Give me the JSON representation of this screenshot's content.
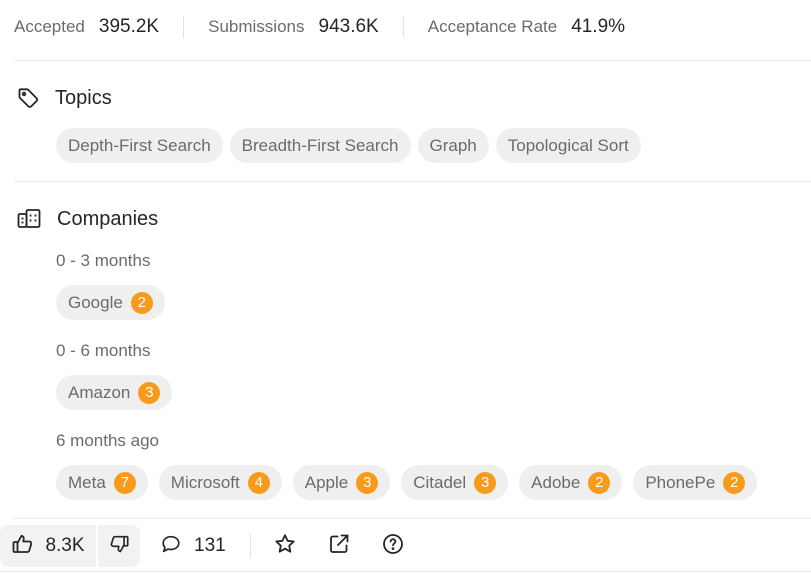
{
  "stats": {
    "accepted_label": "Accepted",
    "accepted_value": "395.2K",
    "submissions_label": "Submissions",
    "submissions_value": "943.6K",
    "acceptance_rate_label": "Acceptance Rate",
    "acceptance_rate_value": "41.9%"
  },
  "topics": {
    "title": "Topics",
    "icon": "tag-icon",
    "tags": [
      "Depth-First Search",
      "Breadth-First Search",
      "Graph",
      "Topological Sort"
    ]
  },
  "companies": {
    "title": "Companies",
    "icon": "building-icon",
    "groups": [
      {
        "period": "0 - 3 months",
        "items": [
          {
            "name": "Google",
            "count": "2"
          }
        ]
      },
      {
        "period": "0 - 6 months",
        "items": [
          {
            "name": "Amazon",
            "count": "3"
          }
        ]
      },
      {
        "period": "6 months ago",
        "items": [
          {
            "name": "Meta",
            "count": "7"
          },
          {
            "name": "Microsoft",
            "count": "4"
          },
          {
            "name": "Apple",
            "count": "3"
          },
          {
            "name": "Citadel",
            "count": "3"
          },
          {
            "name": "Adobe",
            "count": "2"
          },
          {
            "name": "PhonePe",
            "count": "2"
          }
        ]
      }
    ]
  },
  "actions": {
    "likes": "8.3K",
    "comments": "131",
    "icons": [
      "thumbs-up-icon",
      "thumbs-down-icon",
      "comment-icon",
      "star-icon",
      "share-icon",
      "help-icon"
    ]
  },
  "colors": {
    "badge": "#f89b1c",
    "chip_bg": "#efefef",
    "muted_text": "#6b6b6b",
    "text": "#262626"
  }
}
